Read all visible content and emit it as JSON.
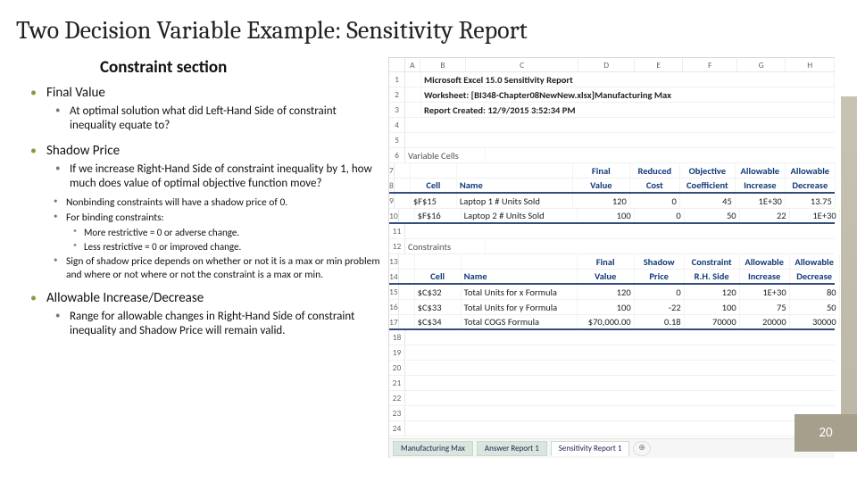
{
  "title": "Two Decision Variable Example: Sensitivity Report",
  "section": "Constraint section",
  "slide_number": "20",
  "bullets": {
    "final_value": {
      "heading": "Final Value",
      "sub": "At optimal solution what did Left-Hand Side of constraint inequality equate to?"
    },
    "shadow_price": {
      "heading": "Shadow Price",
      "sub": "If we increase Right-Hand Side of constraint inequality by 1, how much does value of optimal objective function move?",
      "notes": {
        "n1": "Nonbinding constraints will have a shadow price of 0.",
        "n2": "For binding constraints:",
        "n2a": "More restrictive = 0 or adverse change.",
        "n2b": "Less restrictive = 0 or improved change.",
        "n3": "Sign of shadow price depends on whether or not it is a max or min problem and where or not where or not the constraint is a max or min."
      }
    },
    "allowable": {
      "heading": "Allowable Increase/Decrease",
      "sub": "Range for allowable changes in Right-Hand Side of constraint inequality and Shadow Price will remain valid."
    }
  },
  "excel": {
    "cols": [
      "A",
      "B",
      "C",
      "D",
      "E",
      "F",
      "G",
      "H"
    ],
    "report_title": "Microsoft Excel 15.0 Sensitivity Report",
    "worksheet": "Worksheet: [BI348-Chapter08NewNew.xlsx]Manufacturing Max",
    "created": "Report Created: 12/9/2015 3:52:34 PM",
    "var_section": "Variable Cells",
    "var_head": {
      "cell": "Cell",
      "name": "Name",
      "fv": "Final",
      "fv2": "Value",
      "rc": "Reduced",
      "rc2": "Cost",
      "oc": "Objective",
      "oc2": "Coefficient",
      "ai": "Allowable",
      "ai2": "Increase",
      "ad": "Allowable",
      "ad2": "Decrease"
    },
    "var_rows": [
      {
        "cell": "$F$15",
        "name": "Laptop 1 # Units Sold",
        "fv": "120",
        "rc": "0",
        "oc": "45",
        "ai": "1E+30",
        "ad": "13.75"
      },
      {
        "cell": "$F$16",
        "name": "Laptop 2 # Units Sold",
        "fv": "100",
        "rc": "0",
        "oc": "50",
        "ai": "22",
        "ad": "1E+30"
      }
    ],
    "con_section": "Constraints",
    "con_head": {
      "cell": "Cell",
      "name": "Name",
      "fv": "Final",
      "fv2": "Value",
      "sp": "Shadow",
      "sp2": "Price",
      "rhs": "Constraint",
      "rhs2": "R.H. Side",
      "ai": "Allowable",
      "ai2": "Increase",
      "ad": "Allowable",
      "ad2": "Decrease"
    },
    "con_rows": [
      {
        "cell": "$C$32",
        "name": "Total Units for x Formula",
        "fv": "120",
        "sp": "0",
        "rhs": "120",
        "ai": "1E+30",
        "ad": "80"
      },
      {
        "cell": "$C$33",
        "name": "Total Units for y Formula",
        "fv": "100",
        "sp": "-22",
        "rhs": "100",
        "ai": "75",
        "ad": "50"
      },
      {
        "cell": "$C$34",
        "name": "Total COGS Formula",
        "fv": "$70,000.00",
        "sp": "0.18",
        "rhs": "70000",
        "ai": "20000",
        "ad": "30000"
      }
    ],
    "tabs": {
      "t1": "Manufacturing Max",
      "t2": "Answer Report 1",
      "t3": "Sensitivity Report 1"
    }
  }
}
